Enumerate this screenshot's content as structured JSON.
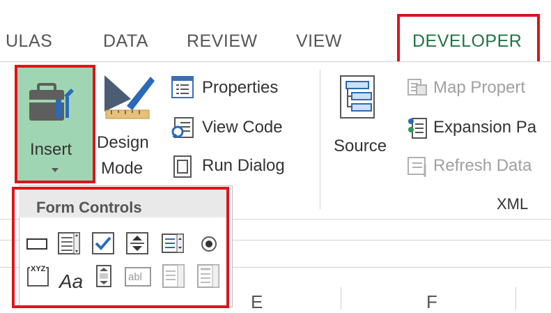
{
  "tabs": [
    {
      "label": "ULAS"
    },
    {
      "label": "DATA"
    },
    {
      "label": "REVIEW"
    },
    {
      "label": "VIEW"
    },
    {
      "label": "DEVELOPER",
      "active": true
    }
  ],
  "ribbon": {
    "insert_label": "Insert",
    "design_mode_line1": "Design",
    "design_mode_line2": "Mode",
    "properties_label": "Properties",
    "view_code_label": "View Code",
    "run_dialog_label": "Run Dialog",
    "source_label": "Source",
    "map_properties_label": "Map Propert",
    "expansion_packs_label": "Expansion Pa",
    "refresh_data_label": "Refresh Data",
    "xml_group_label": "XML"
  },
  "dropdown": {
    "title": "Form Controls",
    "row1": [
      "button-control-icon",
      "combo-box-icon",
      "checkbox-icon",
      "spin-button-icon",
      "list-box-icon",
      "option-button-icon"
    ],
    "row2": [
      "group-box-icon",
      "label-icon",
      "scroll-bar-icon",
      "text-field-icon",
      "combo-list-edit-icon",
      "combo-drop-down-edit-icon"
    ],
    "group_box_text": "XYZ",
    "label_text": "Aa",
    "text_field_text": "abl"
  },
  "column_headers": {
    "e1": "E",
    "e2": "F"
  },
  "colors": {
    "accent": "#217346",
    "highlight": "#e0131b",
    "insert_bg": "#9fd5b2"
  }
}
